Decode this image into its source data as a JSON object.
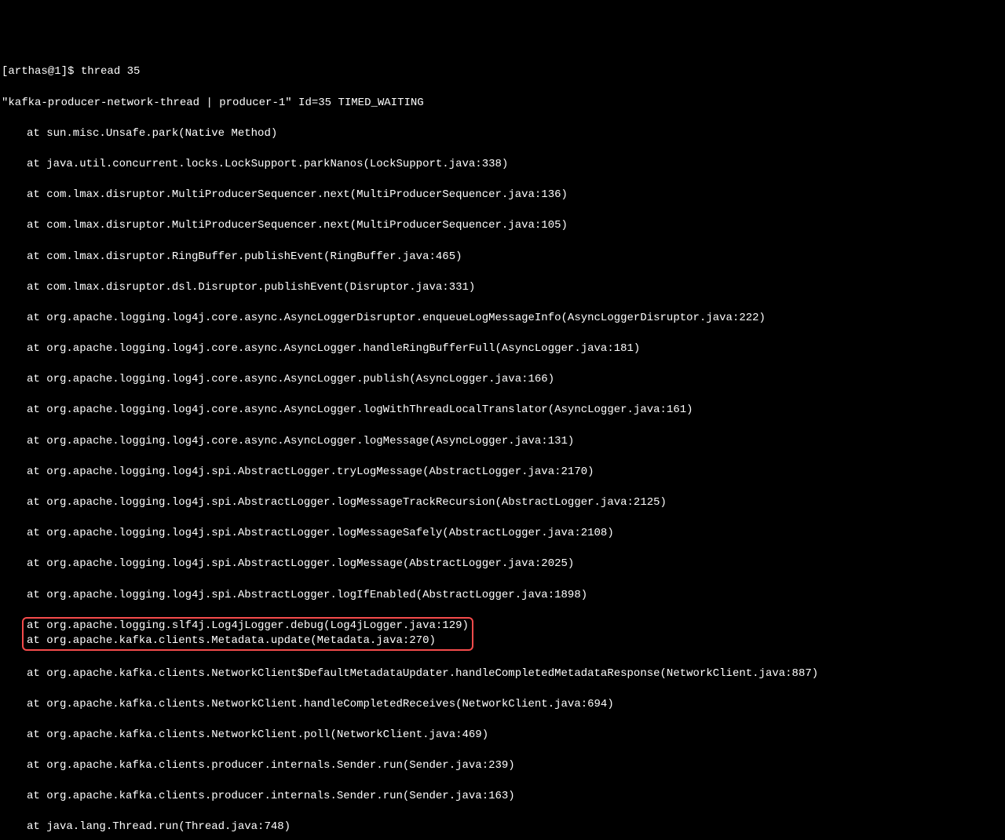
{
  "prompt": "[arthas@1]$ thread 35",
  "thread_header": "\"kafka-producer-network-thread | producer-1\" Id=35 TIMED_WAITING",
  "stack": [
    "at sun.misc.Unsafe.park(Native Method)",
    "at java.util.concurrent.locks.LockSupport.parkNanos(LockSupport.java:338)",
    "at com.lmax.disruptor.MultiProducerSequencer.next(MultiProducerSequencer.java:136)",
    "at com.lmax.disruptor.MultiProducerSequencer.next(MultiProducerSequencer.java:105)",
    "at com.lmax.disruptor.RingBuffer.publishEvent(RingBuffer.java:465)",
    "at com.lmax.disruptor.dsl.Disruptor.publishEvent(Disruptor.java:331)",
    "at org.apache.logging.log4j.core.async.AsyncLoggerDisruptor.enqueueLogMessageInfo(AsyncLoggerDisruptor.java:222)",
    "at org.apache.logging.log4j.core.async.AsyncLogger.handleRingBufferFull(AsyncLogger.java:181)",
    "at org.apache.logging.log4j.core.async.AsyncLogger.publish(AsyncLogger.java:166)",
    "at org.apache.logging.log4j.core.async.AsyncLogger.logWithThreadLocalTranslator(AsyncLogger.java:161)",
    "at org.apache.logging.log4j.core.async.AsyncLogger.logMessage(AsyncLogger.java:131)",
    "at org.apache.logging.log4j.spi.AbstractLogger.tryLogMessage(AbstractLogger.java:2170)",
    "at org.apache.logging.log4j.spi.AbstractLogger.logMessageTrackRecursion(AbstractLogger.java:2125)",
    "at org.apache.logging.log4j.spi.AbstractLogger.logMessageSafely(AbstractLogger.java:2108)",
    "at org.apache.logging.log4j.spi.AbstractLogger.logMessage(AbstractLogger.java:2025)",
    "at org.apache.logging.log4j.spi.AbstractLogger.logIfEnabled(AbstractLogger.java:1898)"
  ],
  "highlighted": {
    "top": "at org.apache.logging.slf4j.Log4jLogger.debug(Log4jLogger.java:129)",
    "bottom": "at org.apache.kafka.clients.Metadata.update(Metadata.java:270)"
  },
  "stack_after": [
    "at org.apache.kafka.clients.NetworkClient$DefaultMetadataUpdater.handleCompletedMetadataResponse(NetworkClient.java:887)",
    "at org.apache.kafka.clients.NetworkClient.handleCompletedReceives(NetworkClient.java:694)",
    "at org.apache.kafka.clients.NetworkClient.poll(NetworkClient.java:469)",
    "at org.apache.kafka.clients.producer.internals.Sender.run(Sender.java:239)",
    "at org.apache.kafka.clients.producer.internals.Sender.run(Sender.java:163)",
    "at java.lang.Thread.run(Thread.java:748)"
  ]
}
